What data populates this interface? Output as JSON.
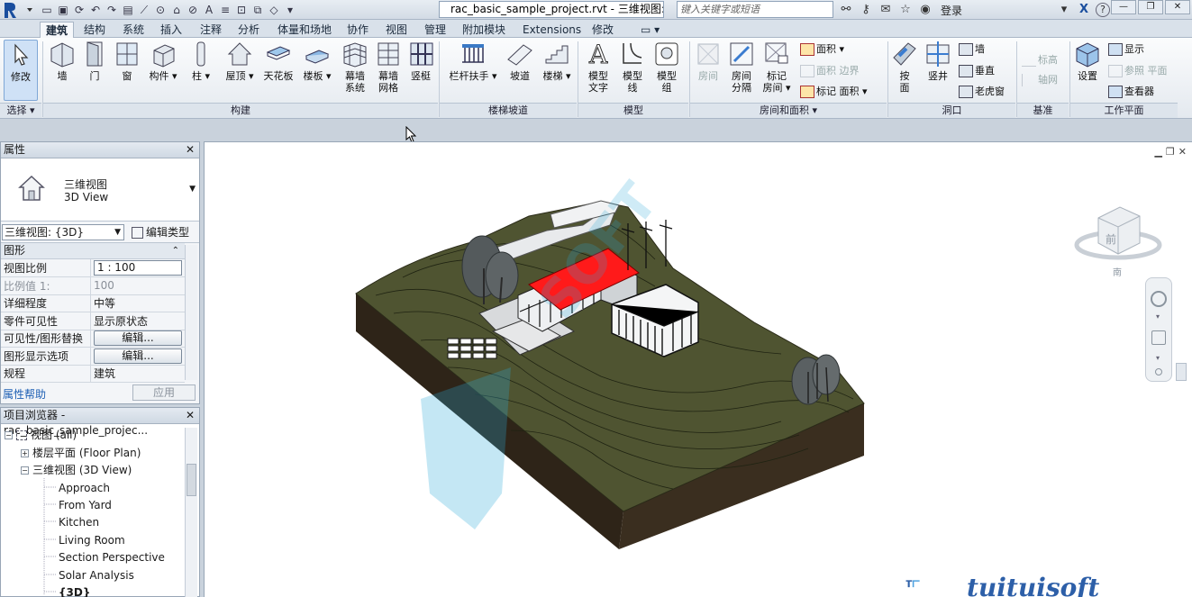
{
  "titlebar": {
    "document_title": "rac_basic_sample_project.rvt - 三维视图: ...",
    "search_placeholder": "键入关键字或短语",
    "login_label": "登录",
    "help_label": "?"
  },
  "tabs": [
    "建筑",
    "结构",
    "系统",
    "插入",
    "注释",
    "分析",
    "体量和场地",
    "协作",
    "视图",
    "管理",
    "附加模块",
    "Extensions",
    "修改"
  ],
  "ribbon": {
    "modify": "修改",
    "select_panel": "选择",
    "build": {
      "wall": "墙",
      "door": "门",
      "window": "窗",
      "component": "构件",
      "column": "柱",
      "roof": "屋顶",
      "ceiling": "天花板",
      "floor": "楼板",
      "curtain_system_1": "幕墙",
      "curtain_system_2": "系统",
      "curtain_grid_1": "幕墙",
      "curtain_grid_2": "网格",
      "mullion": "竖梃",
      "panel": "构建"
    },
    "circulation": {
      "railing": "栏杆扶手",
      "ramp": "坡道",
      "stair": "楼梯",
      "panel": "楼梯坡道"
    },
    "model": {
      "model_text_1": "模型",
      "model_text_2": "文字",
      "model_line_1": "模型",
      "model_line_2": "线",
      "model_group_1": "模型",
      "model_group_2": "组",
      "panel": "模型"
    },
    "room": {
      "room": "房间",
      "room_sep_1": "房间",
      "room_sep_2": "分隔",
      "tag_room_1": "标记",
      "tag_room_2": "房间",
      "area": "面积",
      "area_boundary_1": "面积",
      "area_boundary_2": "边界",
      "tag": "标记",
      "tag_area": "面积",
      "panel": "房间和面积"
    },
    "opening": {
      "by_face_1": "按",
      "by_face_2": "面",
      "shaft": "竖井",
      "wall": "墙",
      "vertical": "垂直",
      "dormer": "老虎窗",
      "panel": "洞口"
    },
    "datum": {
      "level": "标高",
      "grid": "轴网",
      "panel": "基准"
    },
    "workplane": {
      "set": "设置",
      "show": "显示",
      "ref_plane": "参照 平面",
      "viewer": "查看器",
      "panel": "工作平面"
    }
  },
  "properties": {
    "title": "属性",
    "type_cn": "三维视图",
    "type_en": "3D View",
    "view_selector": "三维视图: {3D}",
    "edit_type": "编辑类型",
    "group_graphics": "图形",
    "rows": [
      {
        "key": "视图比例",
        "value": "1 : 100"
      },
      {
        "key": "比例值 1:",
        "value": "100"
      },
      {
        "key": "详细程度",
        "value": "中等"
      },
      {
        "key": "零件可见性",
        "value": "显示原状态"
      },
      {
        "key": "可见性/图形替换",
        "value": "编辑..."
      },
      {
        "key": "图形显示选项",
        "value": "编辑..."
      },
      {
        "key": "规程",
        "value": "建筑"
      }
    ],
    "help_link": "属性帮助",
    "apply_button": "应用"
  },
  "browser": {
    "title": "项目浏览器 - rac_basic_sample_projec...",
    "root": "视图 (all)",
    "floor_plan": "楼层平面 (Floor Plan)",
    "view3d": "三维视图 (3D View)",
    "views": [
      "Approach",
      "From Yard",
      "Kitchen",
      "Living Room",
      "Section Perspective",
      "Solar Analysis",
      "{3D}"
    ]
  },
  "viewport": {
    "viewcube_label": "前",
    "watermark_text": "tuituisoft"
  },
  "colors": {
    "terrain_top": "#4f5431",
    "terrain_side": "#352b1e",
    "roof": "#ff1a1a",
    "tab_text": "#1b2a3c",
    "link": "#1d5fb4"
  }
}
